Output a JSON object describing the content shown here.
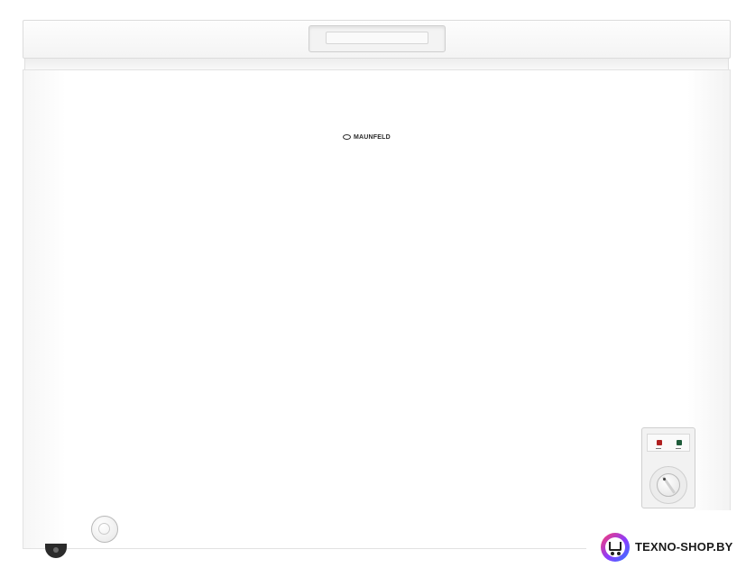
{
  "product": {
    "brand_text": "MAUNFELD",
    "body_color": "#ffffff"
  },
  "control_panel": {
    "left_led_color": "#b02020",
    "right_led_color": "#1f5c3a"
  },
  "watermark": {
    "text": "TEXNO-SHOP.BY",
    "icon": "shopping-cart-icon"
  }
}
